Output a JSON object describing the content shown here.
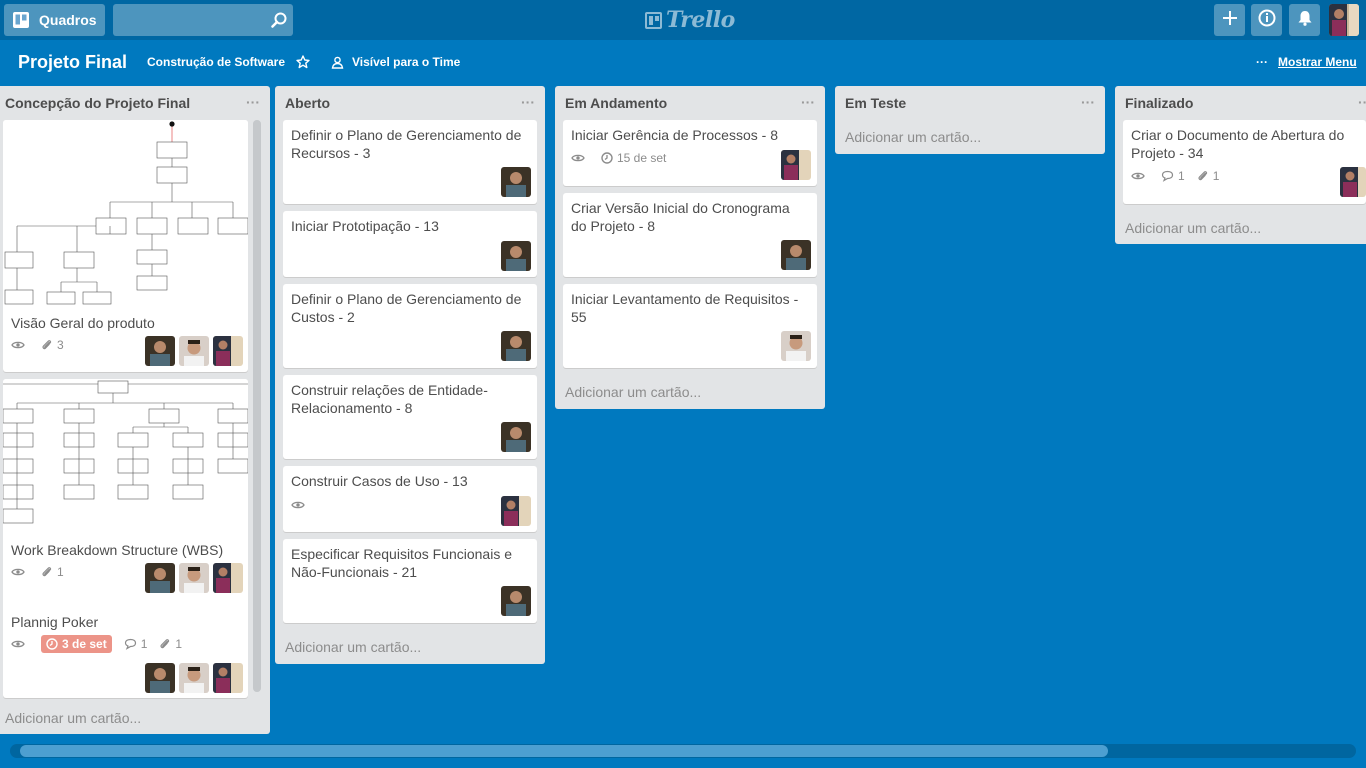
{
  "header": {
    "boards_label": "Quadros",
    "search_value": "",
    "logo_text": "Trello",
    "icons": [
      "boards-icon",
      "search-icon",
      "plus-icon",
      "info-icon",
      "bell-icon"
    ]
  },
  "board": {
    "title": "Projeto Final",
    "team": "Construção de Software",
    "visibility": "Visível para o Time",
    "menu_label": "Mostrar Menu",
    "menu_dots": "···"
  },
  "add_card_label": "Adicionar um cartão...",
  "lists": [
    {
      "title": "Concepção do Projeto Final",
      "cards": [
        {
          "title": "Visão Geral do produto",
          "attachments": "3"
        },
        {
          "title": "Work Breakdown Structure (WBS)",
          "attachments": "1"
        },
        {
          "title": "Plannig Poker",
          "due": "3 de set",
          "comments": "1",
          "attachments": "1"
        }
      ]
    },
    {
      "title": "Aberto",
      "cards": [
        {
          "title": "Definir o Plano de Gerenciamento de Recursos - 3"
        },
        {
          "title": "Iniciar Prototipação - 13"
        },
        {
          "title": "Definir o Plano de Gerenciamento de Custos - 2"
        },
        {
          "title": "Construir relações de Entidade-Relacionamento - 8"
        },
        {
          "title": "Construir Casos de Uso - 13"
        },
        {
          "title": "Especificar Requisitos Funcionais e Não-Funcionais - 21"
        }
      ]
    },
    {
      "title": "Em Andamento",
      "cards": [
        {
          "title": "Iniciar Gerência de Processos - 8",
          "due": "15 de set"
        },
        {
          "title": "Criar Versão Inicial do Cronograma do Projeto - 8"
        },
        {
          "title": "Iniciar Levantamento de Requisitos - 55"
        }
      ]
    },
    {
      "title": "Em Teste",
      "cards": []
    },
    {
      "title": "Finalizado",
      "cards": [
        {
          "title": "Criar o Documento de Abertura do Projeto - 34",
          "comments": "1",
          "attachments": "1"
        }
      ]
    }
  ],
  "colors": {
    "board_bg": "#0079bf",
    "header_bg": "#0067a3",
    "list_bg": "#e2e4e6",
    "due_overdue": "#ec9488"
  }
}
